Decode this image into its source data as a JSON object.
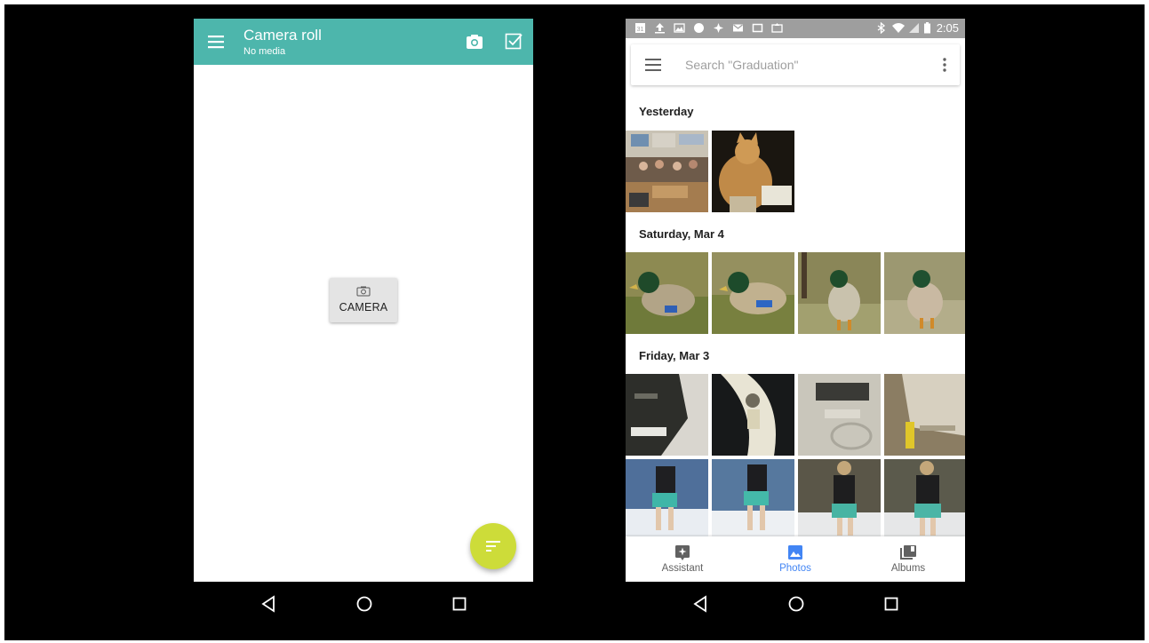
{
  "left_app": {
    "title": "Camera roll",
    "subtitle": "No media",
    "camera_button_label": "CAMERA",
    "icons": [
      "menu-icon",
      "camera-icon",
      "check-box-icon",
      "sort-icon"
    ],
    "accent_color": "#4db6ac",
    "fab_color": "#cddc39"
  },
  "right_app": {
    "status_bar": {
      "time": "2:05",
      "calendar_badge": "31"
    },
    "search": {
      "placeholder": "Search \"Graduation\""
    },
    "sections": [
      {
        "date": "Yesterday",
        "photos": [
          "classroom",
          "cat"
        ]
      },
      {
        "date": "Saturday, Mar 4",
        "photos": [
          "duck",
          "duck",
          "duck",
          "duck"
        ]
      },
      {
        "date": "Friday, Mar 3",
        "photos": [
          "sneaker",
          "sneaker",
          "sneaker",
          "sneaker",
          "person",
          "person",
          "person",
          "person"
        ]
      }
    ],
    "bottom_nav": [
      {
        "label": "Assistant",
        "icon": "assistant-icon",
        "active": false
      },
      {
        "label": "Photos",
        "icon": "photos-icon",
        "active": true
      },
      {
        "label": "Albums",
        "icon": "albums-icon",
        "active": false
      }
    ],
    "active_color": "#4285f4"
  }
}
